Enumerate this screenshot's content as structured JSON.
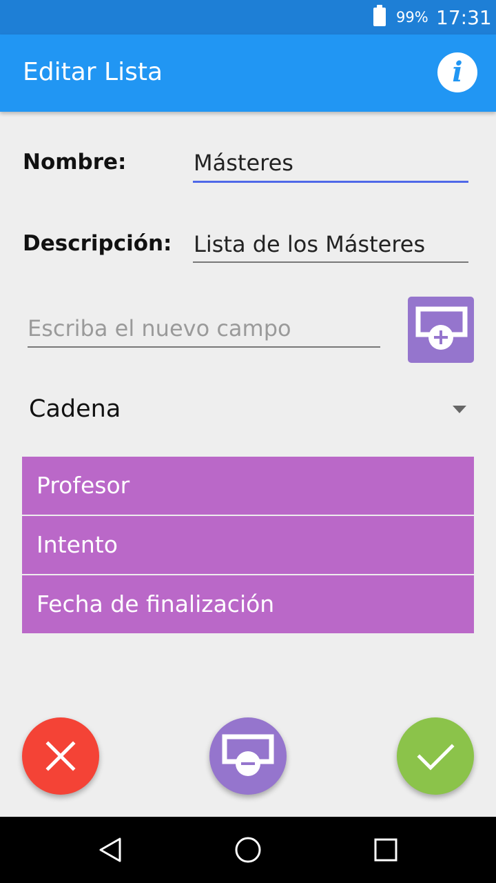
{
  "status_bar": {
    "battery": "99%",
    "time": "17:31",
    "battery_icon": "battery-icon"
  },
  "app_bar": {
    "title": "Editar Lista",
    "info_icon": "info-icon",
    "info_glyph": "i"
  },
  "form": {
    "name_label": "Nombre:",
    "name_value": "Másteres",
    "description_label": "Descripción:",
    "description_value": "Lista de los Másteres",
    "new_field_placeholder": "Escriba el nuevo campo",
    "add_field_icon": "add-field-icon",
    "type_select_value": "Cadena"
  },
  "fields": [
    {
      "label": "Profesor"
    },
    {
      "label": "Intento"
    },
    {
      "label": "Fecha de finalización"
    }
  ],
  "actions": {
    "cancel_icon": "close-icon",
    "remove_icon": "remove-field-icon",
    "accept_icon": "check-icon"
  },
  "colors": {
    "status_bar": "#1e7fd6",
    "app_bar": "#2196f3",
    "field_item": "#ba68c8",
    "add_button": "#9575cd",
    "cancel": "#f44336",
    "accept": "#8bc34a",
    "underline_active": "#4f68e8"
  },
  "nav_bar": {
    "back_icon": "back-icon",
    "home_icon": "home-icon",
    "recents_icon": "recents-icon"
  }
}
